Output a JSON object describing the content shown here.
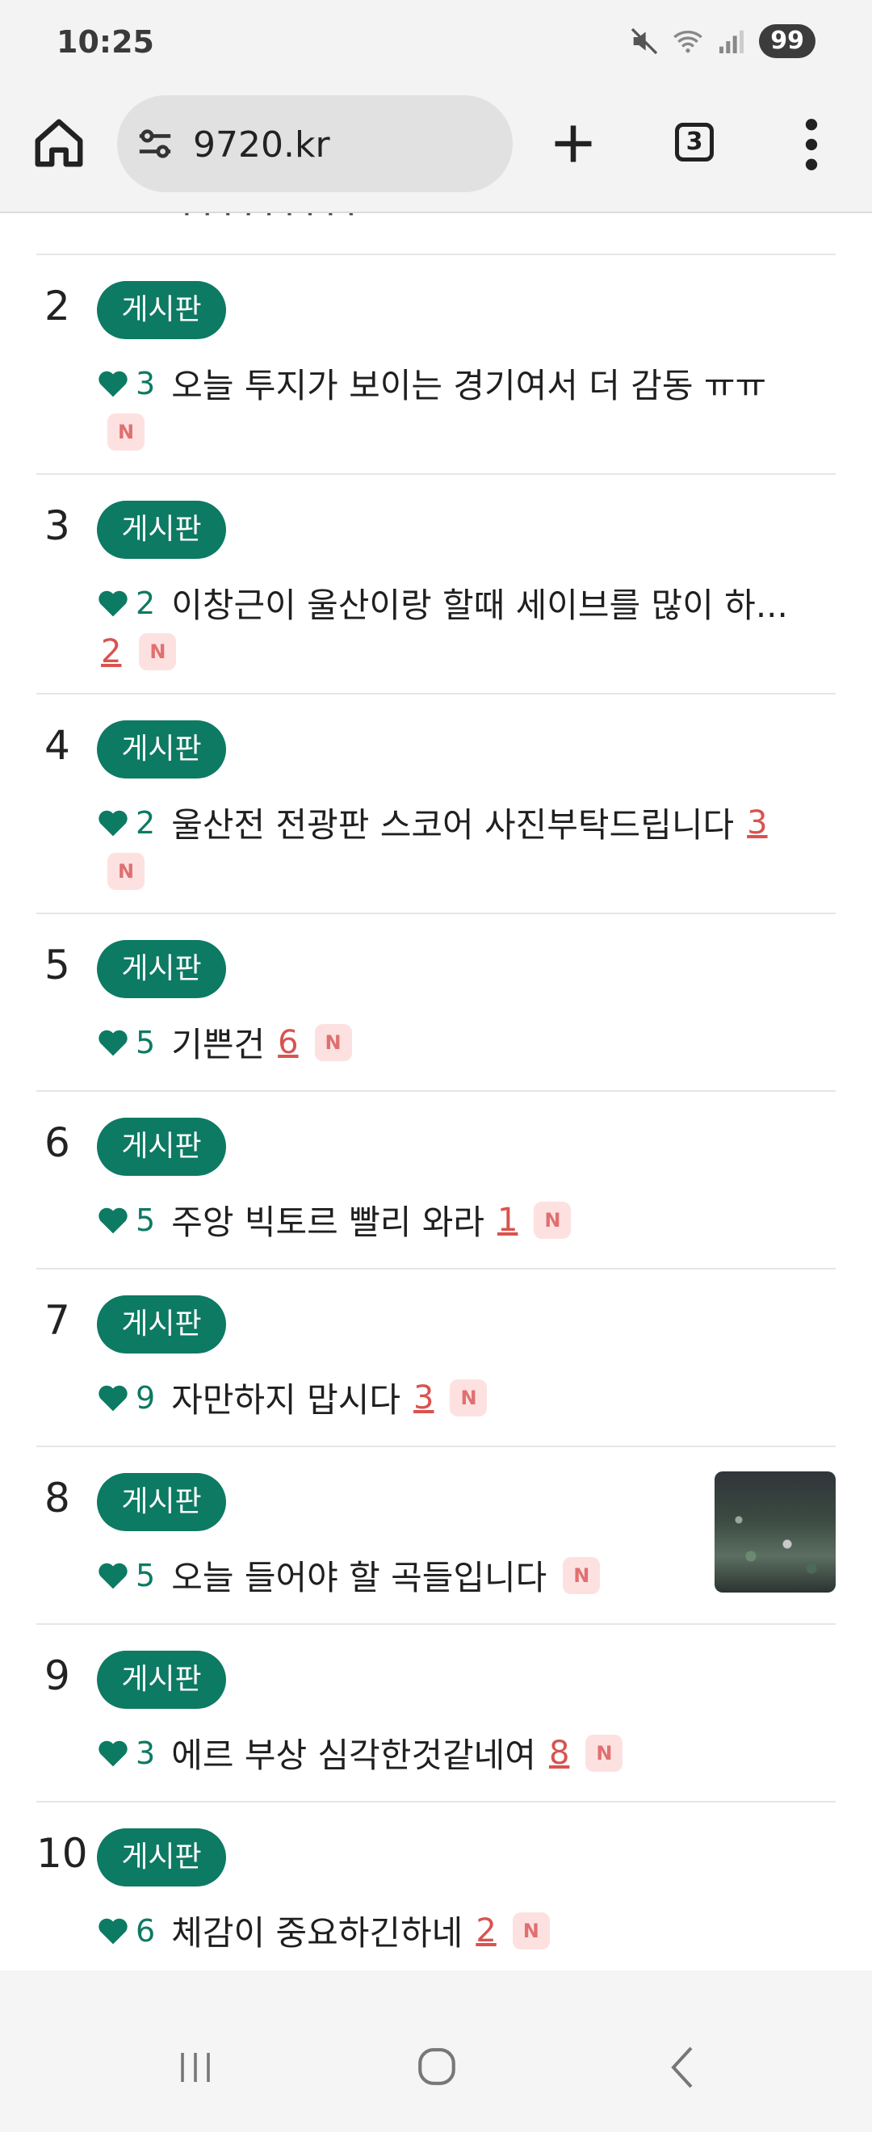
{
  "status_bar": {
    "time": "10:25",
    "battery": "99"
  },
  "browser": {
    "url": "9720.kr",
    "tab_count": "3"
  },
  "posts": [
    {
      "rank": "2",
      "category": "게시판",
      "likes": "3",
      "title": "오늘 투지가 보이는 경기여서 더 감동 ㅠㅠ",
      "comments": "",
      "new_badge": "N",
      "has_thumbnail": false
    },
    {
      "rank": "3",
      "category": "게시판",
      "likes": "2",
      "title": "이창근이 울산이랑 할때 세이브를 많이 하...",
      "comments": "2",
      "new_badge": "N",
      "has_thumbnail": false
    },
    {
      "rank": "4",
      "category": "게시판",
      "likes": "2",
      "title": "울산전 전광판 스코어 사진부탁드립니다",
      "comments": "3",
      "new_badge": "N",
      "has_thumbnail": false
    },
    {
      "rank": "5",
      "category": "게시판",
      "likes": "5",
      "title": "기쁜건",
      "comments": "6",
      "new_badge": "N",
      "has_thumbnail": false
    },
    {
      "rank": "6",
      "category": "게시판",
      "likes": "5",
      "title": "주앙 빅토르 빨리 와라",
      "comments": "1",
      "new_badge": "N",
      "has_thumbnail": false
    },
    {
      "rank": "7",
      "category": "게시판",
      "likes": "9",
      "title": "자만하지 맙시다",
      "comments": "3",
      "new_badge": "N",
      "has_thumbnail": false
    },
    {
      "rank": "8",
      "category": "게시판",
      "likes": "5",
      "title": "오늘 들어야 할 곡들입니다",
      "comments": "",
      "new_badge": "N",
      "has_thumbnail": true
    },
    {
      "rank": "9",
      "category": "게시판",
      "likes": "3",
      "title": "에르 부상 심각한것같네여",
      "comments": "8",
      "new_badge": "N",
      "has_thumbnail": false
    },
    {
      "rank": "10",
      "category": "게시판",
      "likes": "6",
      "title": "체감이 중요하긴하네",
      "comments": "2",
      "new_badge": "N",
      "has_thumbnail": false
    }
  ],
  "colors": {
    "accent": "#0d7a63",
    "comment": "#d9534f",
    "new_badge_bg": "#fde1e1"
  }
}
